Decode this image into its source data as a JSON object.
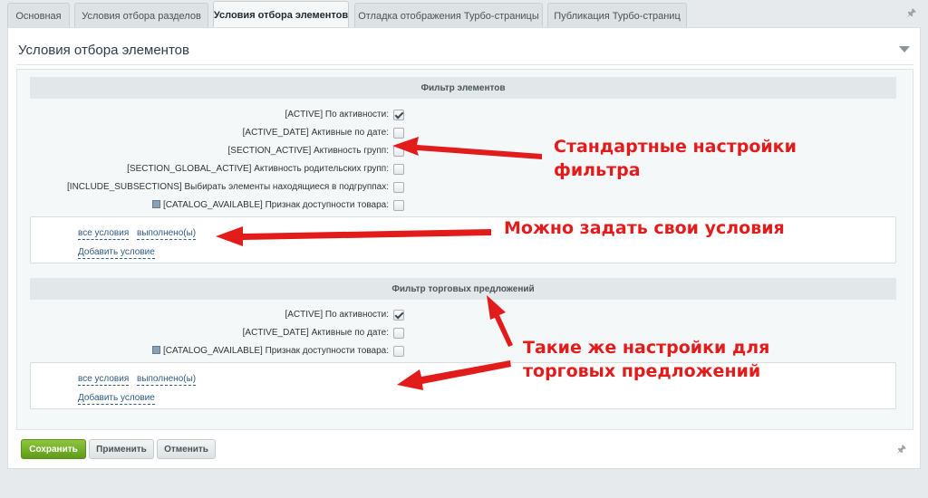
{
  "tabs": [
    {
      "label": "Основная"
    },
    {
      "label": "Условия отбора разделов"
    },
    {
      "label": "Условия отбора элементов"
    },
    {
      "label": "Отладка отображения Турбо-страницы"
    },
    {
      "label": "Публикация Турбо-страниц"
    }
  ],
  "section": {
    "title": "Условия отбора элементов"
  },
  "elements_filter": {
    "header": "Фильтр элементов",
    "rows": [
      {
        "label": "[ACTIVE] По активности:",
        "checked": true
      },
      {
        "label": "[ACTIVE_DATE] Активные по дате:",
        "checked": false
      },
      {
        "label": "[SECTION_ACTIVE] Активность групп:",
        "checked": false
      },
      {
        "label": "[SECTION_GLOBAL_ACTIVE] Активность родительских групп:",
        "checked": false
      },
      {
        "label": "[INCLUDE_SUBSECTIONS] Выбирать элементы находящиеся в подгруппах:",
        "checked": false
      },
      {
        "label": "[CATALOG_AVAILABLE] Признак доступности товара:",
        "checked": false
      }
    ],
    "conditions": {
      "all": "все условия",
      "done": "выполнено(ы)",
      "add": "Добавить условие"
    }
  },
  "offers_filter": {
    "header": "Фильтр торговых предложений",
    "rows": [
      {
        "label": "[ACTIVE] По активности:",
        "checked": true
      },
      {
        "label": "[ACTIVE_DATE] Активные по дате:",
        "checked": false
      },
      {
        "label": "[CATALOG_AVAILABLE] Признак доступности товара:",
        "checked": false
      }
    ],
    "conditions": {
      "all": "все условия",
      "done": "выполнено(ы)",
      "add": "Добавить условие"
    }
  },
  "buttons": {
    "save": "Сохранить",
    "apply": "Применить",
    "cancel": "Отменить"
  },
  "annotations": {
    "standard_line1": "Стандартные настройки",
    "standard_line2": "фильтра",
    "custom": "Можно задать свои условия",
    "offers_line1": "Такие же настройки для",
    "offers_line2": "торговых предложений"
  },
  "colors": {
    "annotation": "#e21b1b",
    "save_button": "#6aa823",
    "link": "#2f5a85"
  },
  "icons": {
    "pin": "pin-icon",
    "collapse": "chevron-down-icon",
    "catalog": "catalog-icon"
  }
}
